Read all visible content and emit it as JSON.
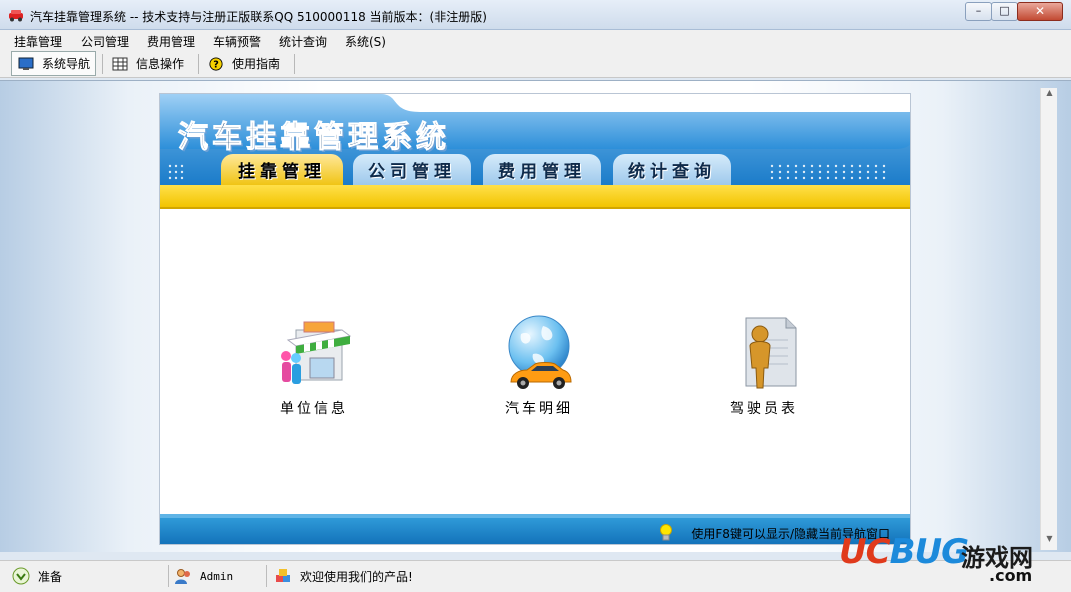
{
  "window": {
    "title": "汽车挂靠管理系统 -- 技术支持与注册正版联系QQ 510000118    当前版本：(非注册版)",
    "minimize": "–",
    "maximize": "□",
    "close": "✕"
  },
  "menubar": {
    "items": [
      "挂靠管理",
      "公司管理",
      "费用管理",
      "车辆预警",
      "统计查询",
      "系统(S)"
    ]
  },
  "toolbar": {
    "items": [
      {
        "label": "系统导航",
        "icon": "monitor-icon",
        "active": true
      },
      {
        "label": "信息操作",
        "icon": "grid-icon",
        "active": false
      },
      {
        "label": "使用指南",
        "icon": "help-icon",
        "active": false
      }
    ]
  },
  "panel": {
    "system_title": "汽车挂靠管理系统",
    "tabs": [
      {
        "label": "挂靠管理",
        "active": true
      },
      {
        "label": "公司管理",
        "active": false
      },
      {
        "label": "费用管理",
        "active": false
      },
      {
        "label": "统计查询",
        "active": false
      }
    ],
    "nav_items": [
      {
        "label": "单位信息",
        "icon": "shop-icon"
      },
      {
        "label": "汽车明细",
        "icon": "car-globe-icon"
      },
      {
        "label": "驾驶员表",
        "icon": "person-icon"
      }
    ],
    "hint": "使用F8键可以显示/隐藏当前导航窗口"
  },
  "statusbar": {
    "status": "准备",
    "user": "Admin",
    "message": "欢迎使用我们的产品!"
  },
  "watermark": {
    "brand_uc": "UC",
    "brand_bug": "BUG",
    "brand_cn": "游戏网",
    "brand_com": ".com"
  },
  "colors": {
    "banner_blue": "#2f8fd8",
    "tab_active": "#f0c415",
    "band_yellow": "#ffd51a",
    "footer_blue": "#1170b8"
  }
}
